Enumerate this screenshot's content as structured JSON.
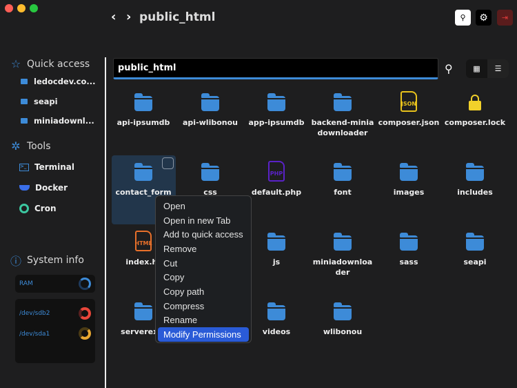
{
  "window": {
    "title": "public_html",
    "traffic": [
      "#fe5f57",
      "#febc2e",
      "#28c840"
    ]
  },
  "toolbar": {
    "back": "‹",
    "forward": "›",
    "search_icon": "search-icon",
    "settings_icon": "gear-icon",
    "logout_icon": "logout-icon"
  },
  "sidebar": {
    "quick_access": {
      "label": "Quick access",
      "items": [
        {
          "label": "ledocdev.co..."
        },
        {
          "label": "seapi"
        },
        {
          "label": "miniadownl..."
        }
      ]
    },
    "tools": {
      "label": "Tools",
      "items": [
        {
          "label": "Terminal"
        },
        {
          "label": "Docker"
        },
        {
          "label": "Cron"
        }
      ]
    },
    "system_info": {
      "label": "System info",
      "ram": {
        "label": "RAM",
        "color": "#3d8bd8"
      },
      "disks": [
        {
          "label": "/dev/sdb2",
          "color": "#e8463a"
        },
        {
          "label": "/dev/sda1",
          "color": "#e8a832"
        }
      ]
    }
  },
  "path_input": {
    "value": "public_html"
  },
  "files": [
    {
      "name": "api-ipsumdb",
      "type": "folder"
    },
    {
      "name": "api-wlibonou",
      "type": "folder"
    },
    {
      "name": "app-ipsumdb",
      "type": "folder"
    },
    {
      "name": "backend-minia downloader",
      "type": "folder"
    },
    {
      "name": "composer.json",
      "type": "json"
    },
    {
      "name": "composer.lock",
      "type": "lock"
    },
    {
      "name": "contact_form",
      "type": "folder",
      "selected": true
    },
    {
      "name": "css",
      "type": "folder"
    },
    {
      "name": "default.php",
      "type": "php"
    },
    {
      "name": "font",
      "type": "folder"
    },
    {
      "name": "images",
      "type": "folder"
    },
    {
      "name": "includes",
      "type": "folder"
    },
    {
      "name": "index.ht",
      "type": "html"
    },
    {
      "name": "",
      "type": "hidden"
    },
    {
      "name": "js",
      "type": "folder"
    },
    {
      "name": "miniadownloa der",
      "type": "folder"
    },
    {
      "name": "sass",
      "type": "folder"
    },
    {
      "name": "seapi",
      "type": "folder"
    },
    {
      "name": "serverexpl",
      "type": "folder"
    },
    {
      "name": "",
      "type": "hidden"
    },
    {
      "name": "videos",
      "type": "folder"
    },
    {
      "name": "wlibonou",
      "type": "folder"
    }
  ],
  "file_badges": {
    "json": "JSON",
    "php": "PHP",
    "html": "HTML"
  },
  "context_menu": {
    "items": [
      "Open",
      "Open in new Tab",
      "Add to quick access",
      "Remove",
      "Cut",
      "Copy",
      "Copy path",
      "Compress",
      "Rename",
      "Modify Permissions"
    ],
    "highlighted": "Modify Permissions"
  }
}
